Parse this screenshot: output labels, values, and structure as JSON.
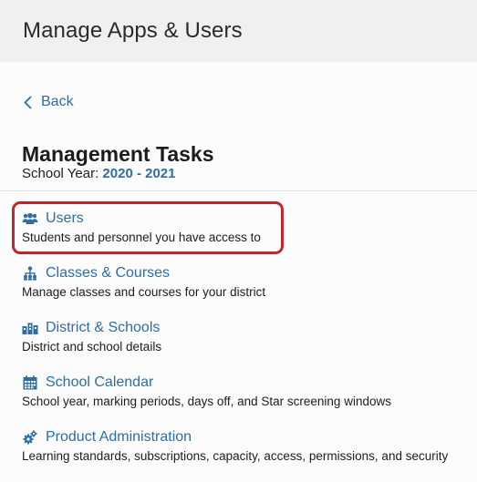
{
  "header": {
    "title": "Manage Apps & Users"
  },
  "nav": {
    "back_label": "Back"
  },
  "section": {
    "title": "Management Tasks",
    "school_year_label": "School Year:",
    "school_year_value": "2020 - 2021"
  },
  "tasks": [
    {
      "label": "Users",
      "description": "Students and personnel you have access to",
      "icon": "users-icon",
      "highlighted": true
    },
    {
      "label": "Classes & Courses",
      "description": "Manage classes and courses for your district",
      "icon": "hierarchy-icon"
    },
    {
      "label": "District & Schools",
      "description": "District and school details",
      "icon": "buildings-icon"
    },
    {
      "label": "School Calendar",
      "description": "School year, marking periods, days off, and Star screening windows",
      "icon": "calendar-icon"
    },
    {
      "label": "Product Administration",
      "description": "Learning standards, subscriptions, capacity, access, permissions, and security",
      "icon": "gears-icon"
    }
  ],
  "colors": {
    "link": "#2e6da4",
    "highlight": "#c0272d",
    "header_bg": "#f0f0f0"
  }
}
